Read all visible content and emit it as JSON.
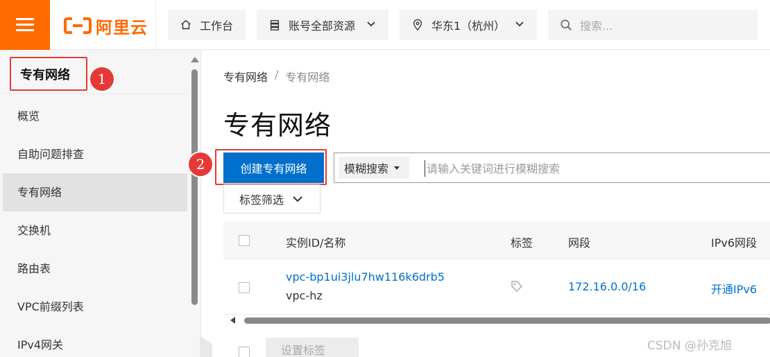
{
  "header": {
    "logo_text": "阿里云",
    "brand_color": "#ff6a00",
    "workbench_label": "工作台",
    "resource_label": "账号全部资源",
    "region_label": "华东1（杭州）",
    "search_placeholder": "搜索..."
  },
  "sidebar": {
    "title": "专有网络",
    "items": [
      {
        "label": "概览"
      },
      {
        "label": "自助问题排查"
      },
      {
        "label": "专有网络"
      },
      {
        "label": "交换机"
      },
      {
        "label": "路由表"
      },
      {
        "label": "VPC前缀列表"
      },
      {
        "label": "IPv4网关"
      }
    ]
  },
  "annotations": {
    "one": "1",
    "two": "2",
    "color": "#e53935"
  },
  "main": {
    "breadcrumb": [
      "专有网络",
      "专有网络"
    ],
    "breadcrumb_sep": "/",
    "title": "专有网络",
    "create_button": "创建专有网络",
    "search_type": "模糊搜索",
    "search_placeholder": "请输入关键词进行模糊搜索",
    "tag_filter": "标签筛选",
    "accent_color": "#0070cc"
  },
  "table": {
    "headers": [
      "实例ID/名称",
      "标签",
      "网段",
      "IPv6网段"
    ],
    "rows": [
      {
        "id": "vpc-bp1ui3jlu7hw116k6drb5",
        "name": "vpc-hz",
        "cidr": "172.16.0.0/16",
        "ipv6": "开通IPv6"
      }
    ]
  },
  "footer": {
    "set_tag": "设置标签"
  },
  "watermark": "CSDN @孙克旭"
}
